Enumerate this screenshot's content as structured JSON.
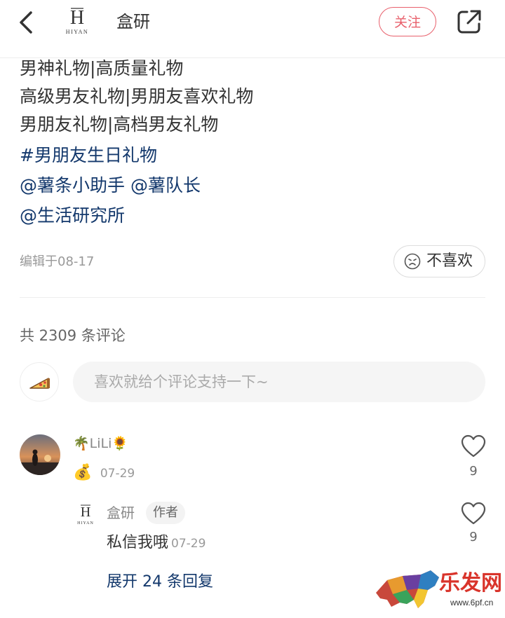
{
  "header": {
    "back_icon": "chevron-left-icon",
    "logo_mark": "H",
    "logo_text": "HIYAN",
    "account_name": "盒研",
    "follow_label": "关注",
    "share_icon": "share-external-icon"
  },
  "post": {
    "lines": [
      "男神礼物|高质量礼物",
      "高级男友礼物|男朋友喜欢礼物",
      "男朋友礼物|高档男友礼物"
    ],
    "hashtag": "#男朋友生日礼物",
    "mentions_line1": "@薯条小助手 @薯队长",
    "mentions_line2": "@生活研究所",
    "edit_date": "编辑于08-17",
    "dislike_label": "不喜欢"
  },
  "comments": {
    "count_label": "共 2309 条评论",
    "input_placeholder": "喜欢就给个评论支持一下~",
    "items": [
      {
        "name": "🌴LiLi🌻",
        "badge_emoji": "💰",
        "date": "07-29",
        "likes": "9",
        "reply": {
          "name": "盒研",
          "badge": "作者",
          "text": "私信我哦",
          "date": "07-29",
          "likes": "9"
        },
        "expand_label": "展开 24 条回复"
      }
    ]
  },
  "watermark": {
    "text": "乐发网",
    "url_text": "www.6pf.cn"
  },
  "colors": {
    "accent_red": "#e8606c",
    "link_blue": "#13386c",
    "text_gray": "#999999"
  }
}
